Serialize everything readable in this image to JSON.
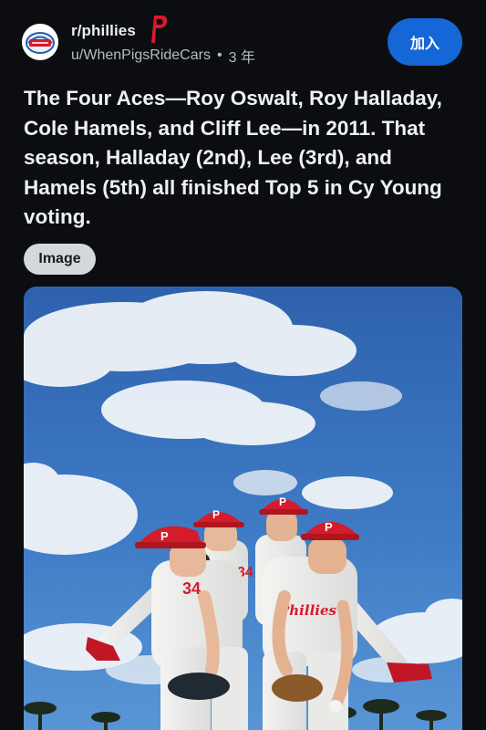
{
  "header": {
    "subreddit": "r/phillies",
    "author": "u/WhenPigsRideCars",
    "separator": "•",
    "age": "3 年",
    "join_label": "加入"
  },
  "post": {
    "title": "The Four Aces—Roy Oswalt, Roy Halladay, Cole Hamels, and Cliff Lee—in 2011. That season, Halladay (2nd), Lee (3rd), and Hamels (5th) all finished Top 5 in Cy Young voting.",
    "badge": "Image"
  },
  "media": {
    "jersey_numbers": [
      "34",
      "34"
    ],
    "jersey_script": "Phillies",
    "cap_letter": "P"
  },
  "colors": {
    "background": "#0b0d10",
    "accent": "#1566d6",
    "phillies_red": "#d41c2c",
    "sky": "#3c77c3"
  },
  "icons": {
    "avatar": "phillies-logo-icon",
    "flair": "phillies-p-icon"
  }
}
